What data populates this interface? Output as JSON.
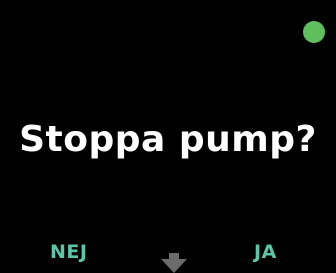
{
  "screen": {
    "question": "Stoppa pump?",
    "softkeys": {
      "left_label": "NEJ",
      "right_label": "JA"
    },
    "scroll_indicator_icon": "down-arrow-icon",
    "status_indicator_icon": "status-dot-icon"
  },
  "colors": {
    "background": "#000000",
    "text": "#ffffff",
    "softkey": "#5bc7a8",
    "status_dot": "#5fbf5c",
    "arrow": "#6b6b6b"
  }
}
